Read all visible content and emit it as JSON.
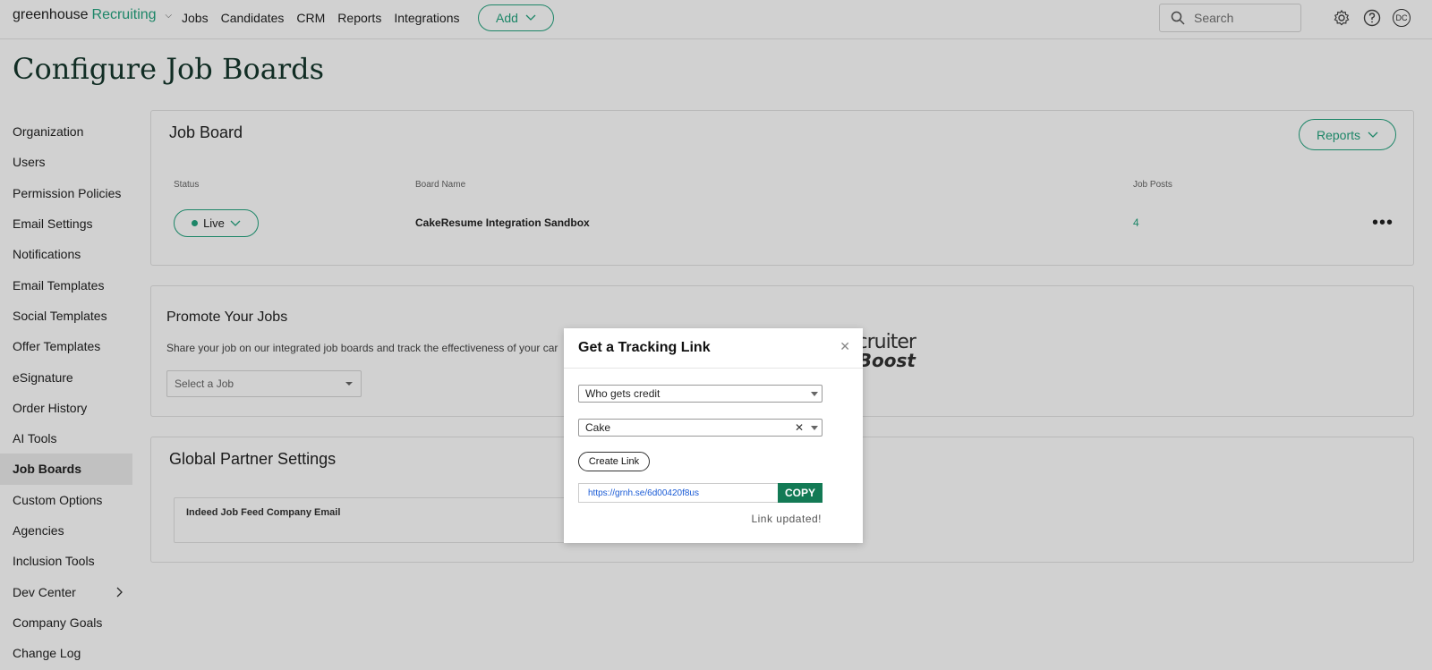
{
  "topnav": {
    "logo_left": "greenhouse",
    "logo_right": "Recruiting",
    "links": [
      "Jobs",
      "Candidates",
      "CRM",
      "Reports",
      "Integrations"
    ],
    "add_label": "Add",
    "search_placeholder": "Search",
    "avatar_initials": "DC"
  },
  "page": {
    "title": "Configure Job Boards"
  },
  "sidebar": {
    "items": [
      {
        "label": "Organization"
      },
      {
        "label": "Users"
      },
      {
        "label": "Permission Policies"
      },
      {
        "label": "Email Settings"
      },
      {
        "label": "Notifications"
      },
      {
        "label": "Email Templates"
      },
      {
        "label": "Social Templates"
      },
      {
        "label": "Offer Templates"
      },
      {
        "label": "eSignature"
      },
      {
        "label": "Order History"
      },
      {
        "label": "AI Tools"
      },
      {
        "label": "Job Boards",
        "active": true
      },
      {
        "label": "Custom Options"
      },
      {
        "label": "Agencies"
      },
      {
        "label": "Inclusion Tools"
      },
      {
        "label": "Dev Center",
        "has_submenu": true
      },
      {
        "label": "Company Goals"
      },
      {
        "label": "Change Log"
      }
    ]
  },
  "job_board": {
    "title": "Job Board",
    "reports_label": "Reports",
    "columns": {
      "status": "Status",
      "board_name": "Board Name",
      "job_posts": "Job Posts"
    },
    "row": {
      "status": "Live",
      "board_name": "CakeResume Integration Sandbox",
      "job_posts": "4"
    }
  },
  "promote": {
    "title": "Promote Your Jobs",
    "subtitle": "Share your job on our integrated job boards and track the effectiveness of your car",
    "select_placeholder": "Select a Job",
    "partner_logo_line1": "ecruiter",
    "partner_logo_line2": "Boost"
  },
  "global_partner": {
    "title": "Global Partner Settings",
    "indeed_label": "Indeed Job Feed Company Email"
  },
  "modal": {
    "title": "Get a Tracking Link",
    "credit_select": "Who gets credit",
    "source_select": "Cake",
    "create_link_label": "Create Link",
    "link_value": "https://grnh.se/6d00420f8us",
    "copy_label": "COPY",
    "status": "Link updated!"
  },
  "colors": {
    "accent": "#24a47f",
    "copy_button": "#137a55",
    "link": "#1a5bd6"
  }
}
